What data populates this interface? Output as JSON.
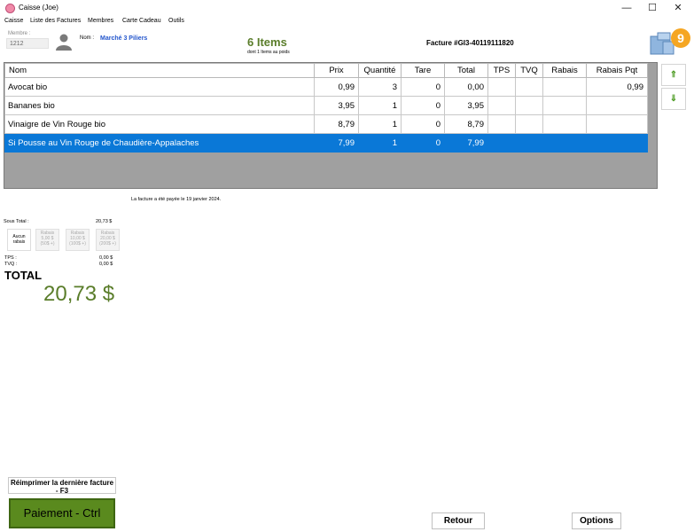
{
  "window": {
    "title": "Caisse (Joe)",
    "minimize": "—",
    "maximize": "☐",
    "close": "✕"
  },
  "menu": [
    "Caisse",
    "Liste des Factures",
    "Membres",
    "Carte Cadeau",
    "Outils"
  ],
  "member": {
    "label": "Membre :",
    "value": "1212",
    "nom_label": "Nom :",
    "nom_value": "Marché 3 Piliers"
  },
  "summary": {
    "items": "6 Items",
    "items_sub": "dont 1 Items au poids",
    "facture": "Facture #GI3-40119111820",
    "badge": "9"
  },
  "table": {
    "columns": [
      "Nom",
      "Prix",
      "Quantité",
      "Tare",
      "Total",
      "TPS",
      "TVQ",
      "Rabais",
      "Rabais Pqt"
    ],
    "rows": [
      [
        "Avocat bio",
        "0,99",
        "3",
        "0",
        "0,00",
        "",
        "",
        "",
        "0,99"
      ],
      [
        "Bananes bio",
        "3,95",
        "1",
        "0",
        "3,95",
        "",
        "",
        "",
        ""
      ],
      [
        "Vinaigre de Vin Rouge bio",
        "8,79",
        "1",
        "0",
        "8,79",
        "",
        "",
        "",
        ""
      ],
      [
        "Si Pousse au Vin Rouge de Chaudière-Appalaches",
        "7,99",
        "1",
        "0",
        "7,99",
        "",
        "",
        "",
        ""
      ]
    ],
    "selected_row": 3
  },
  "scroll": {
    "up": "⇑",
    "down": "⇓"
  },
  "paid_note": "La facture a été payée le 19 janvier 2024.",
  "totals": {
    "sous_total_label": "Sous Total :",
    "sous_total": "20,73 $",
    "rabais": [
      {
        "line1": "Aucun",
        "line2": "rabais",
        "line3": ""
      },
      {
        "line1": "Rabais",
        "line2": "5,00 $",
        "line3": "(50$ +)"
      },
      {
        "line1": "Rabais",
        "line2": "10,00 $",
        "line3": "(100$ +)"
      },
      {
        "line1": "Rabais",
        "line2": "20,00 $",
        "line3": "(200$ +)"
      }
    ],
    "tps_label": "TPS :",
    "tps": "0,00 $",
    "tvq_label": "TVQ :",
    "tvq": "0,00 $",
    "total_label": "TOTAL",
    "total": "20,73 $"
  },
  "buttons": {
    "reprint": "Réimprimer la dernière facture - F3",
    "pay": "Paiement - Ctrl",
    "retour": "Retour",
    "options": "Options"
  },
  "colors": {
    "accent_green": "#5a7d2a",
    "pay_green": "#5a8a1e",
    "selection_blue": "#0a78d7",
    "nom_blue": "#2255cc",
    "badge_orange": "#f5a623"
  }
}
